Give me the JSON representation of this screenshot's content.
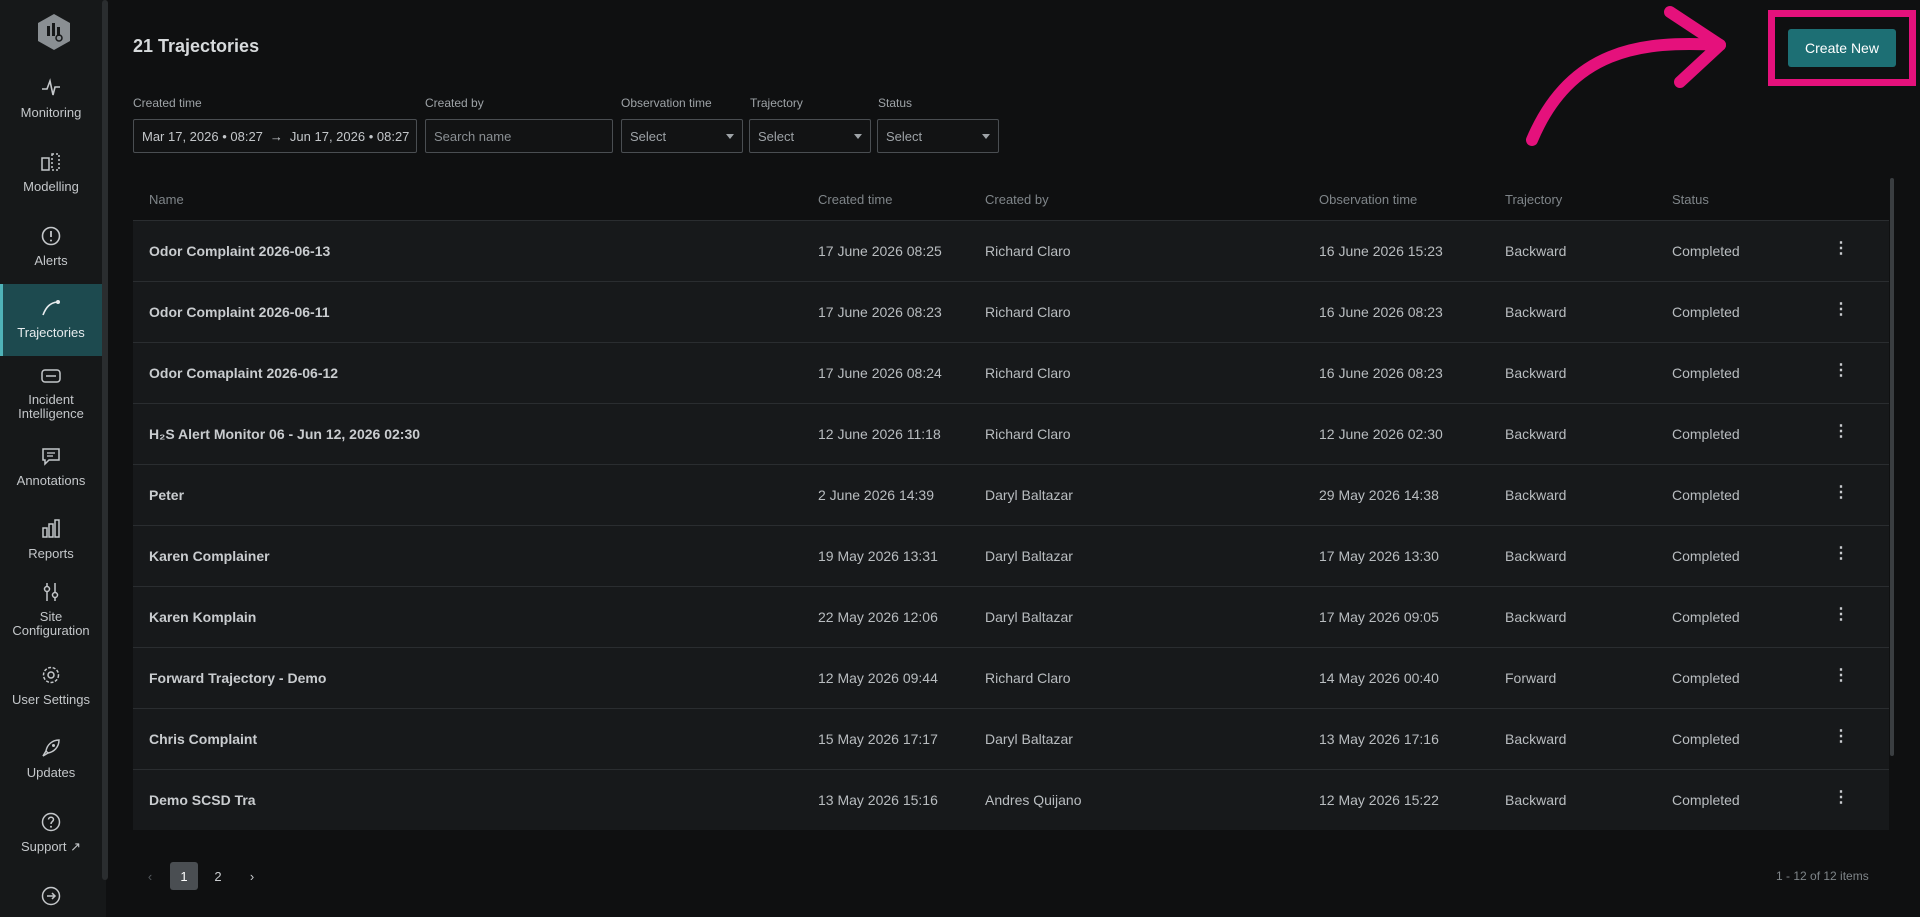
{
  "header": {
    "title": "21 Trajectories",
    "create_button": "Create New"
  },
  "sidebar": {
    "items": [
      {
        "label": "Monitoring",
        "icon": "pulse-icon"
      },
      {
        "label": "Modelling",
        "icon": "modelling-icon"
      },
      {
        "label": "Alerts",
        "icon": "alert-icon"
      },
      {
        "label": "Trajectories",
        "icon": "trajectory-icon",
        "active": true
      },
      {
        "label": "Incident Intelligence",
        "icon": "incident-icon"
      },
      {
        "label": "Annotations",
        "icon": "annotation-icon"
      },
      {
        "label": "Reports",
        "icon": "reports-icon"
      },
      {
        "label": "Site Configuration",
        "icon": "sliders-icon"
      },
      {
        "label": "User Settings",
        "icon": "gear-icon"
      },
      {
        "label": "Updates",
        "icon": "rocket-icon"
      },
      {
        "label": "Support",
        "icon": "help-icon"
      }
    ]
  },
  "filters": {
    "created_time_label": "Created time",
    "date_start": "Mar 17, 2026 • 08:27",
    "date_arrow": "→",
    "date_end": "Jun 17, 2026 • 08:27",
    "created_by_label": "Created by",
    "created_by_placeholder": "Search name",
    "observation_time_label": "Observation time",
    "trajectory_label": "Trajectory",
    "status_label": "Status",
    "select_placeholder": "Select"
  },
  "table": {
    "columns": [
      "Name",
      "Created time",
      "Created by",
      "Observation time",
      "Trajectory",
      "Status"
    ],
    "rows": [
      [
        "Odor Complaint 2026-06-13",
        "17 June 2026 08:25",
        "Richard Claro",
        "16 June 2026 15:23",
        "Backward",
        "Completed"
      ],
      [
        "Odor Complaint 2026-06-11",
        "17 June 2026 08:23",
        "Richard Claro",
        "16 June 2026 08:23",
        "Backward",
        "Completed"
      ],
      [
        "Odor Comaplaint 2026-06-12",
        "17 June 2026 08:24",
        "Richard Claro",
        "16 June 2026 08:23",
        "Backward",
        "Completed"
      ],
      [
        "H₂S Alert Monitor 06 - Jun 12, 2026 02:30",
        "12 June 2026 11:18",
        "Richard Claro",
        "12 June 2026 02:30",
        "Backward",
        "Completed"
      ],
      [
        "Peter",
        "2 June 2026 14:39",
        "Daryl Baltazar",
        "29 May 2026 14:38",
        "Backward",
        "Completed"
      ],
      [
        "Karen Complainer",
        "19 May 2026 13:31",
        "Daryl Baltazar",
        "17 May 2026 13:30",
        "Backward",
        "Completed"
      ],
      [
        "Karen Komplain",
        "22 May 2026 12:06",
        "Daryl Baltazar",
        "17 May 2026 09:05",
        "Backward",
        "Completed"
      ],
      [
        "Forward Trajectory - Demo",
        "12 May 2026 09:44",
        "Richard Claro",
        "14 May 2026 00:40",
        "Forward",
        "Completed"
      ],
      [
        "Chris Complaint",
        "15 May 2026 17:17",
        "Daryl Baltazar",
        "13 May 2026 17:16",
        "Backward",
        "Completed"
      ],
      [
        "Demo SCSD Tra",
        "13 May 2026 15:16",
        "Andres Quijano",
        "12 May 2026 15:22",
        "Backward",
        "Completed"
      ]
    ]
  },
  "pagination": {
    "pages": [
      "1",
      "2"
    ],
    "current": "1",
    "summary": "1 - 12 of 12 items"
  },
  "colors": {
    "accent": "#1d6f74",
    "highlight": "#e5117c",
    "active_nav": "#1d4a4f"
  }
}
